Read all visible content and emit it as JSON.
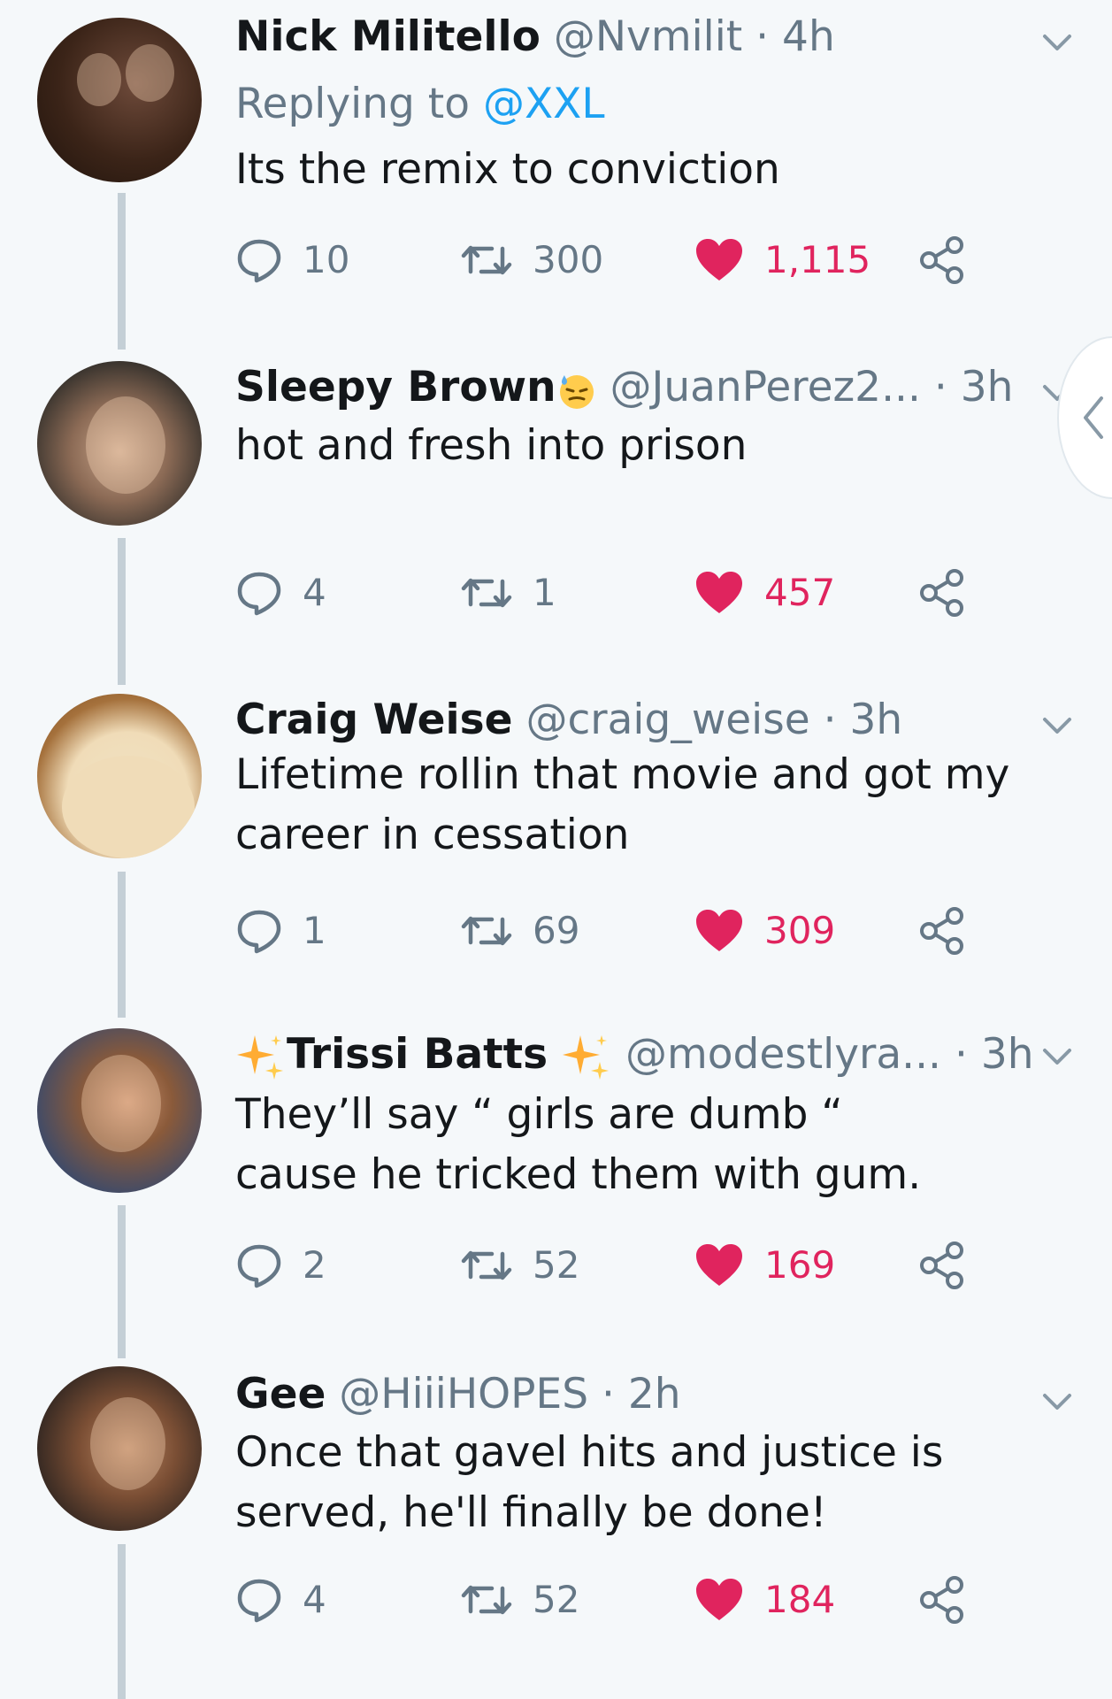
{
  "tweets": [
    {
      "name": "Nick Militello",
      "handle": "@Nvmilit",
      "time": "· 4h",
      "replying_label": "Replying to",
      "replying_handle": "@XXL",
      "text_lines": [
        "Its the remix to conviction"
      ],
      "replies": "10",
      "retweets": "300",
      "likes": "1,115"
    },
    {
      "name": "Sleepy Brown",
      "name_emoji": "sweat-smile-emoji",
      "handle": "@JuanPerez2...",
      "time": "· 3h",
      "text_lines": [
        "hot and fresh into prison"
      ],
      "replies": "4",
      "retweets": "1",
      "likes": "457"
    },
    {
      "name": "Craig Weise",
      "handle": "@craig_weise",
      "time": "· 3h",
      "text_lines": [
        "Lifetime rollin that movie and got my",
        "career in cessation"
      ],
      "replies": "1",
      "retweets": "69",
      "likes": "309"
    },
    {
      "name": "Trissi Batts",
      "name_decor": "sparkles-emoji",
      "handle": "@modestlyra...",
      "time": "· 3h",
      "text_lines": [
        "They’ll say “ girls are dumb “",
        "cause he tricked them with gum."
      ],
      "replies": "2",
      "retweets": "52",
      "likes": "169"
    },
    {
      "name": "Gee",
      "handle": "@HiiiHOPES",
      "time": "· 2h",
      "text_lines": [
        "Once that gavel hits and justice is",
        "served, he'll finally be done!"
      ],
      "replies": "4",
      "retweets": "52",
      "likes": "184"
    }
  ],
  "colors": {
    "background": "#f5f8fa",
    "text": "#14171a",
    "muted": "#657786",
    "link": "#1da1f2",
    "like": "#e0245e",
    "thread_line": "#c4cfd6"
  },
  "icons": [
    "reply-icon",
    "retweet-icon",
    "heart-icon",
    "share-icon",
    "chevron-down-icon",
    "chevron-left-icon"
  ]
}
